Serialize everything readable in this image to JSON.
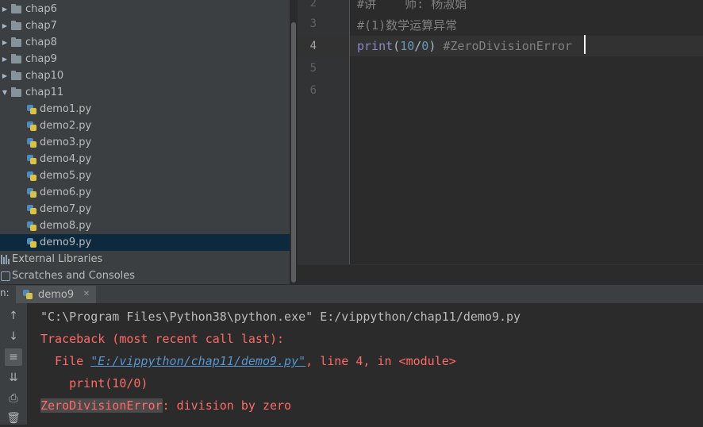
{
  "project_tree": {
    "folders": [
      {
        "label": "chap6",
        "expanded": false
      },
      {
        "label": "chap7",
        "expanded": false
      },
      {
        "label": "chap8",
        "expanded": false
      },
      {
        "label": "chap9",
        "expanded": false
      },
      {
        "label": "chap10",
        "expanded": false
      },
      {
        "label": "chap11",
        "expanded": true
      }
    ],
    "files": [
      "demo1.py",
      "demo2.py",
      "demo3.py",
      "demo4.py",
      "demo5.py",
      "demo6.py",
      "demo7.py",
      "demo8.py",
      "demo9.py"
    ],
    "selected_file": "demo9.py",
    "external_libraries": "External Libraries",
    "scratches": "Scratches and Consoles"
  },
  "editor": {
    "line_numbers": [
      "2",
      "3",
      "4",
      "5",
      "6"
    ],
    "current_line": "4",
    "line2_comment": "#讲    师: 杨淑娟",
    "line3_comment": "#(1)数学运算异常",
    "line4": {
      "keyword": "print",
      "open": "(",
      "num1": "10",
      "op": "/",
      "num2": "0",
      "close": ")",
      "comment": " #ZeroDivisionError"
    }
  },
  "run_panel": {
    "label": "n:",
    "tab_label": "demo9",
    "command": "\"C:\\Program Files\\Python38\\python.exe\" E:/vippython/chap11/demo9.py",
    "traceback_header": "Traceback (most recent call last):",
    "file_prefix": "  File ",
    "file_link": "\"E:/vippython/chap11/demo9.py\"",
    "file_suffix": ", line 4, in <module>",
    "code_line": "    print(10/0)",
    "error_name": "ZeroDivisionError",
    "error_message": ": division by zero"
  },
  "colors": {
    "error": "#ff6b68",
    "link": "#5894cf",
    "selection": "#0d293e"
  }
}
